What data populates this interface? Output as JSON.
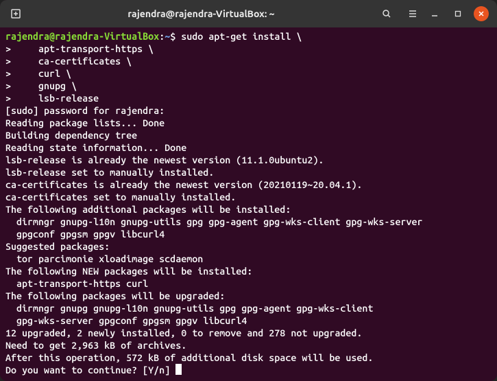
{
  "titlebar": {
    "title": "rajendra@rajendra-VirtualBox: ~"
  },
  "prompt": {
    "user_host": "rajendra@rajendra-VirtualBox",
    "colon": ":",
    "path": "~",
    "dollar": "$ "
  },
  "command": {
    "line0": "sudo apt-get install \\",
    "line1": ">     apt-transport-https \\",
    "line2": ">     ca-certificates \\",
    "line3": ">     curl \\",
    "line4": ">     gnupg \\",
    "line5": ">     lsb-release"
  },
  "output": {
    "l0": "[sudo] password for rajendra:",
    "l1": "Reading package lists... Done",
    "l2": "Building dependency tree",
    "l3": "Reading state information... Done",
    "l4": "lsb-release is already the newest version (11.1.0ubuntu2).",
    "l5": "lsb-release set to manually installed.",
    "l6": "ca-certificates is already the newest version (20210119~20.04.1).",
    "l7": "ca-certificates set to manually installed.",
    "l8": "The following additional packages will be installed:",
    "l9": "  dirmngr gnupg-l10n gnupg-utils gpg gpg-agent gpg-wks-client gpg-wks-server",
    "l10": "  gpgconf gpgsm gpgv libcurl4",
    "l11": "Suggested packages:",
    "l12": "  tor parcimonie xloadimage scdaemon",
    "l13": "The following NEW packages will be installed:",
    "l14": "  apt-transport-https curl",
    "l15": "The following packages will be upgraded:",
    "l16": "  dirmngr gnupg gnupg-l10n gnupg-utils gpg gpg-agent gpg-wks-client",
    "l17": "  gpg-wks-server gpgconf gpgsm gpgv libcurl4",
    "l18": "12 upgraded, 2 newly installed, 0 to remove and 278 not upgraded.",
    "l19": "Need to get 2,963 kB of archives.",
    "l20": "After this operation, 572 kB of additional disk space will be used.",
    "l21": "Do you want to continue? [Y/n] "
  }
}
